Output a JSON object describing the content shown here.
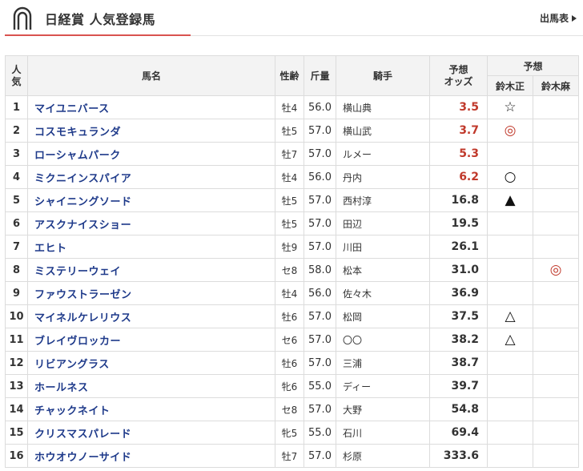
{
  "header": {
    "title": "日経賞 人気登録馬",
    "entries_link": "出馬表"
  },
  "table": {
    "headers": {
      "popularity": "人\n気",
      "horse": "馬名",
      "sex_age": "性齢",
      "weight": "斤量",
      "jockey": "騎手",
      "odds": "予想\nオッズ",
      "prediction": "予想",
      "predictor1": "鈴木正",
      "predictor2": "鈴木麻"
    },
    "rows": [
      {
        "rank": "1",
        "horse": "マイユニバース",
        "sex_age": "牡4",
        "weight": "56.0",
        "jockey": "横山典",
        "odds": "3.5",
        "fav": true,
        "p1": "☆",
        "p2": ""
      },
      {
        "rank": "2",
        "horse": "コスモキュランダ",
        "sex_age": "牡5",
        "weight": "57.0",
        "jockey": "横山武",
        "odds": "3.7",
        "fav": true,
        "p1": "◎",
        "p2": ""
      },
      {
        "rank": "3",
        "horse": "ローシャムパーク",
        "sex_age": "牡7",
        "weight": "57.0",
        "jockey": "ルメー",
        "odds": "5.3",
        "fav": true,
        "p1": "",
        "p2": ""
      },
      {
        "rank": "4",
        "horse": "ミクニインスパイア",
        "sex_age": "牡4",
        "weight": "56.0",
        "jockey": "丹内",
        "odds": "6.2",
        "fav": true,
        "p1": "○",
        "p2": ""
      },
      {
        "rank": "5",
        "horse": "シャイニングソード",
        "sex_age": "牡5",
        "weight": "57.0",
        "jockey": "西村淳",
        "odds": "16.8",
        "fav": false,
        "p1": "▲",
        "p2": ""
      },
      {
        "rank": "6",
        "horse": "アスクナイスショー",
        "sex_age": "牡5",
        "weight": "57.0",
        "jockey": "田辺",
        "odds": "19.5",
        "fav": false,
        "p1": "",
        "p2": ""
      },
      {
        "rank": "7",
        "horse": "エヒト",
        "sex_age": "牡9",
        "weight": "57.0",
        "jockey": "川田",
        "odds": "26.1",
        "fav": false,
        "p1": "",
        "p2": ""
      },
      {
        "rank": "8",
        "horse": "ミステリーウェイ",
        "sex_age": "セ8",
        "weight": "58.0",
        "jockey": "松本",
        "odds": "31.0",
        "fav": false,
        "p1": "",
        "p2": "◎"
      },
      {
        "rank": "9",
        "horse": "ファウストラーゼン",
        "sex_age": "牡4",
        "weight": "56.0",
        "jockey": "佐々木",
        "odds": "36.9",
        "fav": false,
        "p1": "",
        "p2": ""
      },
      {
        "rank": "10",
        "horse": "マイネルケレリウス",
        "sex_age": "牡6",
        "weight": "57.0",
        "jockey": "松岡",
        "odds": "37.5",
        "fav": false,
        "p1": "△",
        "p2": ""
      },
      {
        "rank": "11",
        "horse": "ブレイヴロッカー",
        "sex_age": "セ6",
        "weight": "57.0",
        "jockey": "〇〇",
        "odds": "38.2",
        "fav": false,
        "p1": "△",
        "p2": ""
      },
      {
        "rank": "12",
        "horse": "リビアングラス",
        "sex_age": "牡6",
        "weight": "57.0",
        "jockey": "三浦",
        "odds": "38.7",
        "fav": false,
        "p1": "",
        "p2": ""
      },
      {
        "rank": "13",
        "horse": "ホールネス",
        "sex_age": "牝6",
        "weight": "55.0",
        "jockey": "ディー",
        "odds": "39.7",
        "fav": false,
        "p1": "",
        "p2": ""
      },
      {
        "rank": "14",
        "horse": "チャックネイト",
        "sex_age": "セ8",
        "weight": "57.0",
        "jockey": "大野",
        "odds": "54.8",
        "fav": false,
        "p1": "",
        "p2": ""
      },
      {
        "rank": "15",
        "horse": "クリスマスパレード",
        "sex_age": "牝5",
        "weight": "55.0",
        "jockey": "石川",
        "odds": "69.4",
        "fav": false,
        "p1": "",
        "p2": ""
      },
      {
        "rank": "16",
        "horse": "ホウオウノーサイド",
        "sex_age": "牡7",
        "weight": "57.0",
        "jockey": "杉原",
        "odds": "333.6",
        "fav": false,
        "p1": "",
        "p2": ""
      }
    ]
  },
  "colors": {
    "accent": "#d9534f",
    "horse_link": "#1e3a8a",
    "favorite_odds": "#c0392b"
  },
  "icons": {
    "logo": "horseshoe-icon",
    "link_arrow": "triangle-right-icon"
  }
}
